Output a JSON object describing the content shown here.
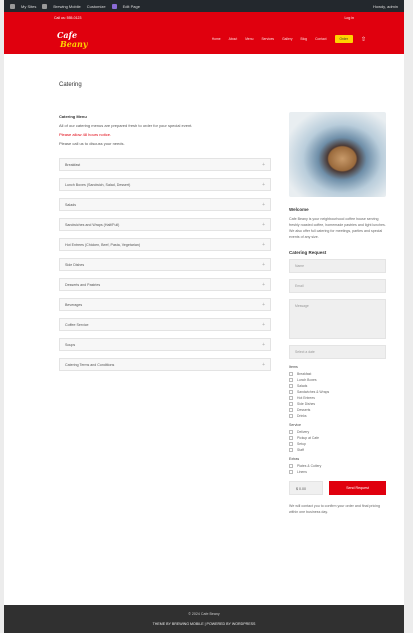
{
  "admin_bar": {
    "items": [
      "My Sites",
      "Brewing Mobile",
      "Customize",
      "Edit Page"
    ],
    "right": "Howdy, admin"
  },
  "top_strip": {
    "phone": "Call us: 555-0123",
    "right": "Log in"
  },
  "header": {
    "logo_top": "Cafe",
    "logo_bottom": "Beany",
    "nav": [
      "Home",
      "About",
      "Menu",
      "Services",
      "Gallery",
      "Blog",
      "Contact"
    ],
    "cta": "Order"
  },
  "page": {
    "title": "Catering",
    "intro_heading": "Catering Menu",
    "intro_lines": [
      "All of our catering menus are prepared fresh to order for your special event.",
      "Please allow 48 hours notice.",
      "Please call us to discuss your needs."
    ],
    "accordion": [
      "Breakfast",
      "Lunch Boxes (Sandwich, Salad, Dessert)",
      "Salads",
      "Sandwiches and Wraps (Half/Full)",
      "Hot Entrees (Chicken, Beef, Pasta, Vegetarian)",
      "Side Dishes",
      "Desserts and Pastries",
      "Beverages",
      "Coffee Service",
      "Soups",
      "Catering Terms and Conditions"
    ]
  },
  "sidebar": {
    "about_heading": "Welcome",
    "about_text": "Cafe Beany is your neighbourhood coffee house serving freshly roasted coffee, homemade pastries and light lunches. We also offer full catering for meetings, parties and special events of any size.",
    "form_heading": "Catering Request",
    "name_placeholder": "Name",
    "email_placeholder": "Email",
    "message_placeholder": "Message",
    "select_value": "Select a date",
    "group1_label": "Items",
    "group1": [
      "Breakfast",
      "Lunch Boxes",
      "Salads",
      "Sandwiches & Wraps",
      "Hot Entrees",
      "Side Dishes",
      "Desserts",
      "Drinks"
    ],
    "group2_label": "Service",
    "group2": [
      "Delivery",
      "Pickup at Cafe",
      "Setup",
      "Staff"
    ],
    "group3_label": "Extras",
    "group3": [
      "Plates & Cutlery",
      "Linens"
    ],
    "price": "$ 0.00",
    "submit": "Send Request",
    "note": "We will contact you to confirm your order and final pricing within one business day."
  },
  "footer": {
    "line1": "© 2024 Cafe Beany",
    "line2": "THEME BY BREWING MOBILE  |  POWERED BY WORDPRESS"
  }
}
